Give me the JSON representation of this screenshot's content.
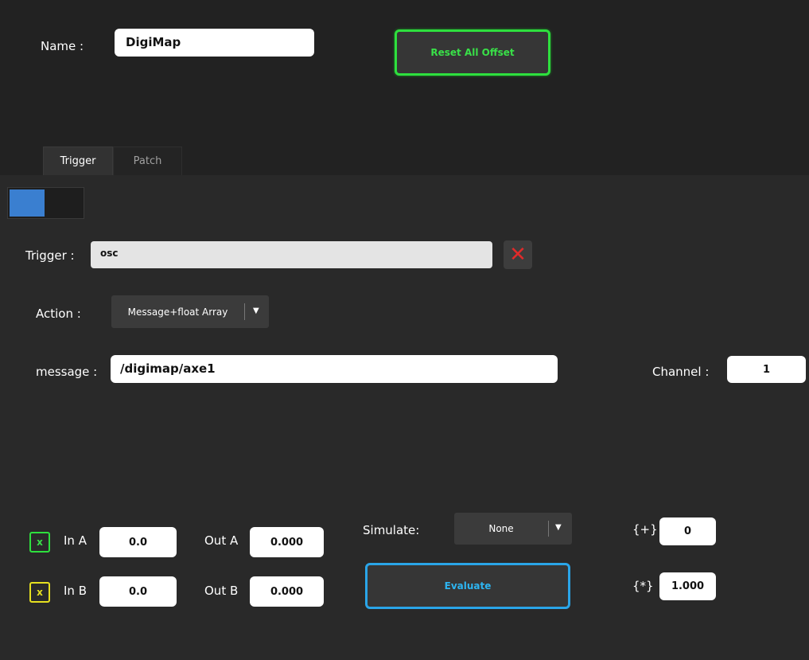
{
  "header": {
    "name_label": "Name :",
    "name_value": "DigiMap",
    "reset_button": "Reset All Offset"
  },
  "tabs": [
    {
      "label": "Trigger",
      "active": true
    },
    {
      "label": "Patch",
      "active": false
    }
  ],
  "trigger": {
    "label": "Trigger :",
    "value": "osc",
    "clear_glyph": "✕"
  },
  "action": {
    "label": "Action :",
    "selected": "Message+float Array"
  },
  "message": {
    "label": "message :",
    "value": "/digimap/axe1"
  },
  "channel": {
    "label": "Channel :",
    "value": "1"
  },
  "inputs": {
    "check_glyph": "x",
    "in_a_label": "In A",
    "in_a_value": "0.0",
    "out_a_label": "Out A",
    "out_a_value": "0.000",
    "in_b_label": "In B",
    "in_b_value": "0.0",
    "out_b_label": "Out B",
    "out_b_value": "0.000"
  },
  "simulate": {
    "label": "Simulate:",
    "selected": "None"
  },
  "evaluate_button": "Evaluate",
  "offset": {
    "plus_label": "{+}",
    "plus_value": "0",
    "mult_label": "{*}",
    "mult_value": "1.000"
  },
  "colors": {
    "accent_green": "#2ee03e",
    "accent_yellow": "#e6e020",
    "accent_blue": "#2aa5e8",
    "toggle_blue": "#3a7fd0",
    "clear_red": "#e02a2a"
  }
}
